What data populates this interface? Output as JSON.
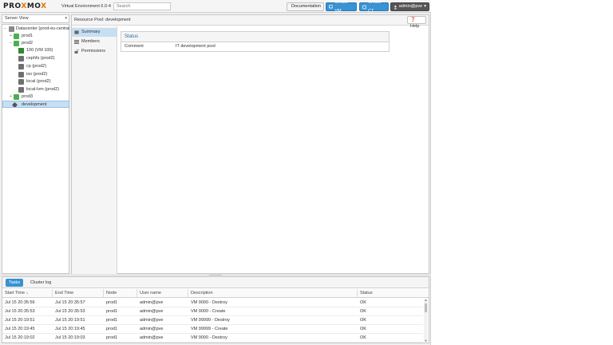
{
  "header": {
    "logo_prefix": "PRO",
    "logo_x": "X",
    "logo_mid": "MO",
    "logo_x2": "X",
    "version": "Virtual Environment 6.0-4",
    "search_placeholder": "Search",
    "documentation_label": "Documentation",
    "create_vm_label": "Create VM",
    "create_ct_label": "Create CT",
    "user_label": "admin@pve"
  },
  "tree": {
    "view_label": "Server View",
    "items": [
      {
        "label": "Datacenter (prod-eu-central)",
        "icon": "datacenter-icon"
      },
      {
        "label": "prod1",
        "icon": "node-icon"
      },
      {
        "label": "prod2",
        "icon": "node-icon"
      },
      {
        "label": "100 (VM 100)",
        "icon": "vm-icon"
      },
      {
        "label": "cephfs (prod2)",
        "icon": "storage-icon"
      },
      {
        "label": "cp (prod2)",
        "icon": "storage-icon"
      },
      {
        "label": "iso (prod2)",
        "icon": "storage-icon"
      },
      {
        "label": "local (prod2)",
        "icon": "storage-icon"
      },
      {
        "label": "local-lvm (prod2)",
        "icon": "storage-icon"
      },
      {
        "label": "prod3",
        "icon": "node-icon"
      },
      {
        "label": "development",
        "icon": "tags-icon"
      }
    ]
  },
  "content": {
    "title": "Resource Pool: development",
    "help_label": "Help",
    "nav": [
      {
        "label": "Summary",
        "icon": "book-icon"
      },
      {
        "label": "Members",
        "icon": "list-icon"
      },
      {
        "label": "Permissions",
        "icon": "unlock-icon"
      }
    ],
    "status": {
      "header": "Status",
      "key": "Comment",
      "value": "IT development pool"
    }
  },
  "tasks": {
    "tab_tasks": "Tasks",
    "tab_cluster_log": "Cluster log",
    "columns": [
      "Start Time ↓",
      "End Time",
      "Node",
      "User name",
      "Description",
      "Status"
    ],
    "rows": [
      [
        "Jul 15 20:35:56",
        "Jul 15 20:35:57",
        "prod1",
        "admin@pve",
        "VM 9000 - Destroy",
        "OK"
      ],
      [
        "Jul 15 20:35:53",
        "Jul 15 20:35:53",
        "prod1",
        "admin@pve",
        "VM 9000 - Create",
        "OK"
      ],
      [
        "Jul 15 20:19:51",
        "Jul 15 20:19:51",
        "prod1",
        "admin@pve",
        "VM 99999 - Destroy",
        "OK"
      ],
      [
        "Jul 15 20:19:45",
        "Jul 15 20:19:45",
        "prod1",
        "admin@pve",
        "VM 99999 - Create",
        "OK"
      ],
      [
        "Jul 15 20:19:02",
        "Jul 15 20:19:03",
        "prod1",
        "admin@pve",
        "VM 9000 - Destroy",
        "OK"
      ]
    ]
  },
  "colors": {
    "accent": "#3892d4",
    "selection": "#c7dff3",
    "logo_orange": "#e57000",
    "node_green": "#4caf50"
  }
}
